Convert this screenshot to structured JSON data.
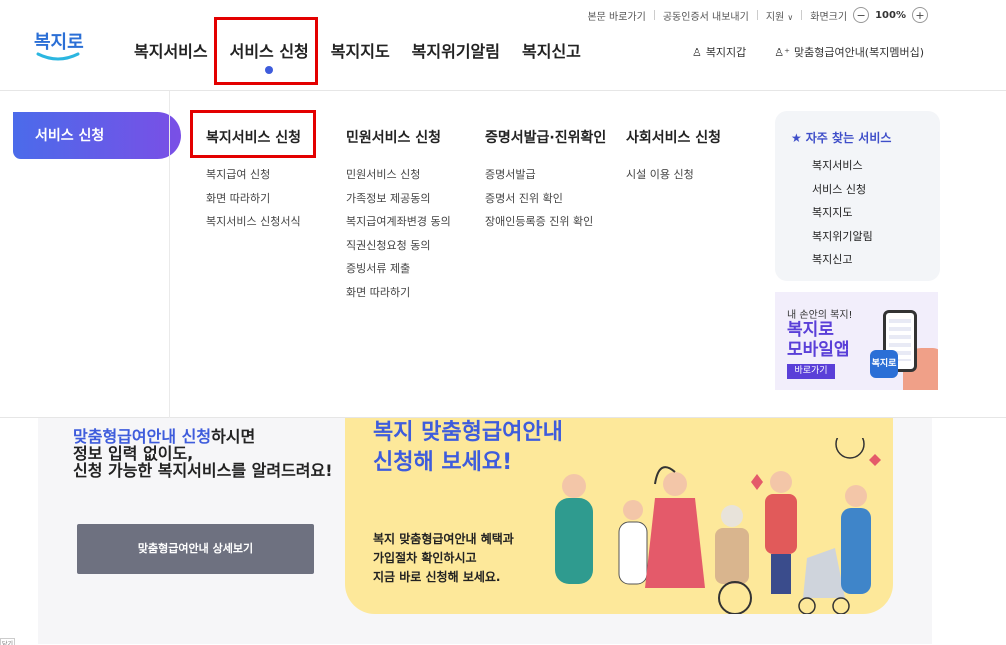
{
  "utility": {
    "skip_link": "본문 바로가기",
    "cert_export": "공동인증서 내보내기",
    "support": "지원",
    "support_caret": "∨",
    "screen_size": "화면크기",
    "zoom_minus": "−",
    "zoom_value": "100%",
    "zoom_plus": "+"
  },
  "logo": {
    "text": "복지로"
  },
  "nav": {
    "items": [
      "복지서비스",
      "서비스 신청",
      "복지지도",
      "복지위기알림",
      "복지신고"
    ],
    "right": {
      "wallet": "복지지갑",
      "membership": "맞춤형급여안내(복지멤버십)"
    }
  },
  "mega": {
    "side_label": "서비스 신청",
    "columns": [
      {
        "title": "복지서비스 신청",
        "links": [
          "복지급여 신청",
          "화면 따라하기",
          "복지서비스 신청서식"
        ]
      },
      {
        "title": "민원서비스 신청",
        "links": [
          "민원서비스 신청",
          "가족정보 제공동의",
          "복지급여계좌변경 동의",
          "직권신청요청 동의",
          "증빙서류 제출",
          "화면 따라하기"
        ]
      },
      {
        "title": "증명서발급·진위확인",
        "links": [
          "증명서발급",
          "증명서 진위 확인",
          "장애인등록증 진위 확인"
        ]
      },
      {
        "title": "사회서비스 신청",
        "links": [
          "시설 이용 신청"
        ]
      }
    ],
    "favorites": {
      "title": "자주 찾는 서비스",
      "items": [
        "복지서비스",
        "서비스 신청",
        "복지지도",
        "복지위기알림",
        "복지신고"
      ]
    },
    "banner": {
      "line1": "내 손안의 복지!",
      "line2": "복지로",
      "line3": "모바일앱",
      "button": "바로가기",
      "phone_logo": "복지로"
    }
  },
  "promo": {
    "left_blue": "맞춤형급여안내 신청",
    "left_rest": "하시면",
    "left_line2": "정보 입력 없이도,",
    "left_line3": "신청 가능한 복지서비스를 알려드려요!",
    "detail_button": "맞춤형급여안내 상세보기",
    "yellow_title1": "복지 맞춤형급여안내",
    "yellow_title2": "신청해 보세요!",
    "yellow_desc1": "복지 맞춤형급여안내 혜택과",
    "yellow_desc2": "가입절차 확인하시고",
    "yellow_desc3": "지금 바로 신청해 보세요."
  },
  "corner_tag": "닫기",
  "colors": {
    "accent": "#3e5cdc",
    "highlight_border": "#e30000",
    "promo_bg": "#fde89a"
  }
}
